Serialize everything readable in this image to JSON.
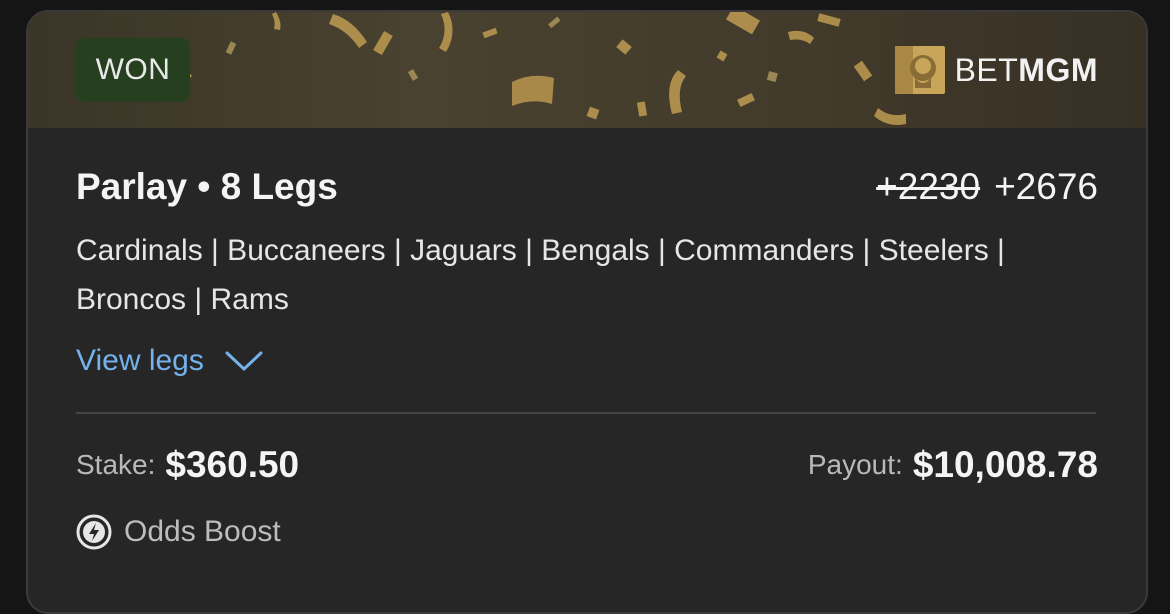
{
  "bet": {
    "status": "WON",
    "brand": {
      "prefix": "BET",
      "name": "MGM"
    },
    "title": "Parlay • 8 Legs",
    "odds": {
      "original": "+2230",
      "boosted": "+2676"
    },
    "legs_summary": "Cardinals | Buccaneers | Jaguars | Bengals | Commanders | Steelers | Broncos | Rams",
    "view_legs_label": "View legs",
    "stake": {
      "label": "Stake:",
      "value": "$360.50"
    },
    "payout": {
      "label": "Payout:",
      "value": "$10,008.78"
    },
    "boost_label": "Odds Boost"
  },
  "colors": {
    "card_bg": "#262626",
    "banner_gold": "#c9a55a",
    "won_badge_bg": "#26401f",
    "link_blue": "#74b2ec"
  }
}
